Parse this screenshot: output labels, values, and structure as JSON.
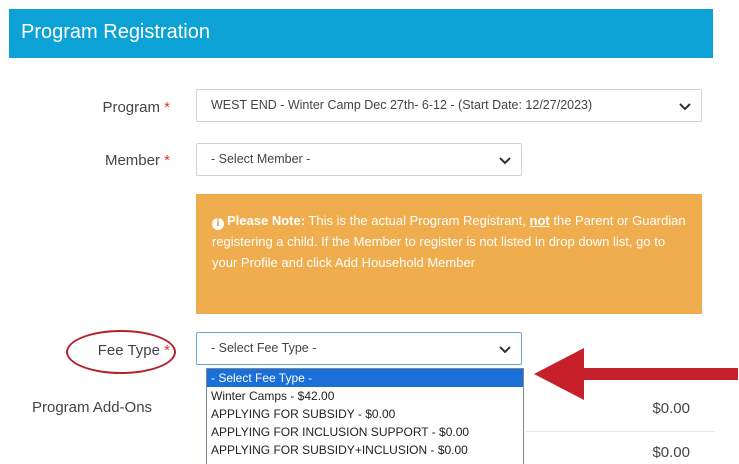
{
  "header": {
    "title": "Program Registration"
  },
  "form": {
    "required_marker": "*",
    "program": {
      "label": "Program",
      "value": "WEST END - Winter Camp Dec 27th- 6-12 - (Start Date: 12/27/2023)"
    },
    "member": {
      "label": "Member",
      "value": "- Select Member -"
    },
    "note": {
      "icon": "info-circle-icon",
      "bold_prefix": "Please Note:",
      "text_before": " This is the actual Program Registrant, ",
      "emphasis": "not",
      "text_after": " the Parent or Guardian registering a child. If the Member to register is not listed in drop down list, go to your Profile and click Add Household Member"
    },
    "fee_type": {
      "label": "Fee Type",
      "value": "- Select Fee Type -",
      "options": [
        "- Select Fee Type -",
        "Winter Camps - $42.00",
        "APPLYING FOR SUBSIDY - $0.00",
        "APPLYING FOR INCLUSION SUPPORT - $0.00",
        "APPLYING FOR SUBSIDY+INCLUSION - $0.00"
      ],
      "selected_index": 0
    },
    "addons": {
      "label": "Program Add-Ons",
      "amount_1": "$0.00",
      "amount_2": "$0.00"
    }
  },
  "colors": {
    "header_bg": "#0da2d6",
    "note_bg": "#f0ad4e",
    "required": "#e0333c",
    "annotation": "#b5202a",
    "selected_option": "#1a6fd8"
  }
}
